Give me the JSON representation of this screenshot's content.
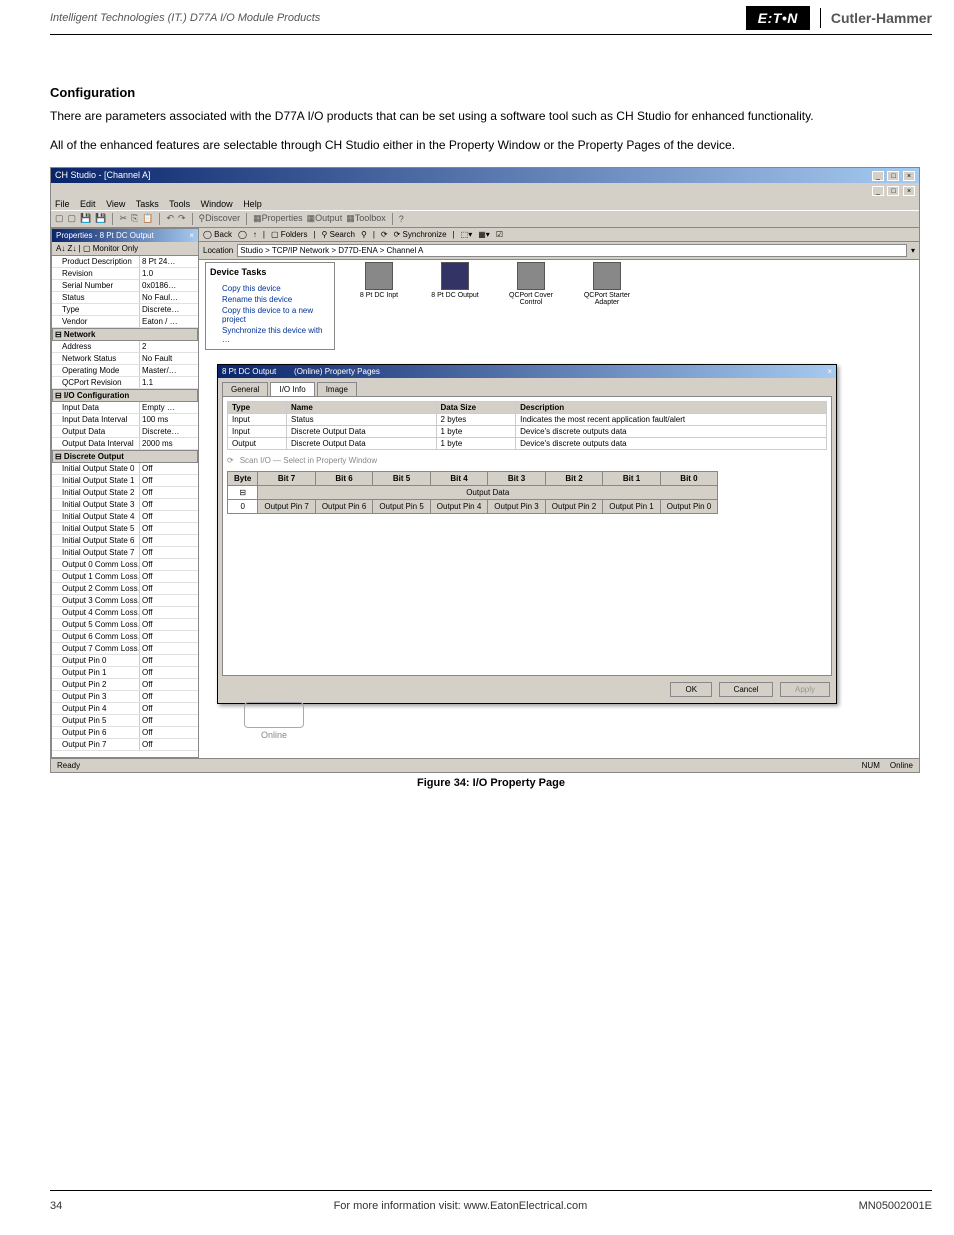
{
  "header": {
    "product_line": "Intelligent Technologies (IT.) D77A I/O Module Products",
    "brand1": "E:T•N",
    "brand2": "Cutler-Hammer"
  },
  "section_title": "Configuration",
  "paragraph1": "There are parameters associated with the D77A I/O products that can be set using a software tool such as CH Studio for enhanced functionality.",
  "paragraph2": "All of the enhanced features are selectable through CH Studio either in the Property Window or the Property Pages of the device.",
  "figure_caption": "Figure 34: I/O Property Page",
  "app": {
    "title": "CH Studio - [Channel A]",
    "menus": [
      "File",
      "Edit",
      "View",
      "Tasks",
      "Tools",
      "Window",
      "Help"
    ],
    "toolbar2": [
      "◯ Back",
      "◯",
      "↑",
      "▢ Folders",
      "⚲ Search",
      "⚲",
      "⟳",
      "⟳ Synchronize",
      "⬚▾",
      "▦▾",
      "☑"
    ],
    "location_label": "Location",
    "location_value": "Studio > TCP/IP Network > D77D-ENA > Channel A",
    "properties": {
      "title": "Properties - 8 Pt DC Output",
      "toolbar": "A↓  Z↓  | ▢ Monitor Only",
      "categories": [
        {
          "name": "",
          "rows": [
            {
              "k": "Product Description",
              "v": "8 Pt 24…"
            },
            {
              "k": "Revision",
              "v": "1.0"
            },
            {
              "k": "Serial Number",
              "v": "0x0186…"
            },
            {
              "k": "Status",
              "v": "No Faul…"
            },
            {
              "k": "Type",
              "v": "Discrete…"
            },
            {
              "k": "Vendor",
              "v": "Eaton / …"
            }
          ]
        },
        {
          "name": "Network",
          "rows": [
            {
              "k": "Address",
              "v": "2"
            },
            {
              "k": "Network Status",
              "v": "No Fault"
            },
            {
              "k": "Operating Mode",
              "v": "Master/…"
            },
            {
              "k": "QCPort Revision",
              "v": "1.1"
            }
          ]
        },
        {
          "name": "I/O Configuration",
          "rows": [
            {
              "k": "Input Data",
              "v": "Empty …"
            },
            {
              "k": "Input Data Interval",
              "v": "100 ms"
            },
            {
              "k": "Output Data",
              "v": "Discrete…"
            },
            {
              "k": "Output Data Interval",
              "v": "2000 ms"
            }
          ]
        },
        {
          "name": "Discrete Output",
          "rows": [
            {
              "k": "Initial Output State 0",
              "v": "Off"
            },
            {
              "k": "Initial Output State 1",
              "v": "Off"
            },
            {
              "k": "Initial Output State 2",
              "v": "Off"
            },
            {
              "k": "Initial Output State 3",
              "v": "Off"
            },
            {
              "k": "Initial Output State 4",
              "v": "Off"
            },
            {
              "k": "Initial Output State 5",
              "v": "Off"
            },
            {
              "k": "Initial Output State 6",
              "v": "Off"
            },
            {
              "k": "Initial Output State 7",
              "v": "Off"
            },
            {
              "k": "Output 0 Comm Loss…",
              "v": "Off"
            },
            {
              "k": "Output 1 Comm Loss…",
              "v": "Off"
            },
            {
              "k": "Output 2 Comm Loss…",
              "v": "Off"
            },
            {
              "k": "Output 3 Comm Loss…",
              "v": "Off"
            },
            {
              "k": "Output 4 Comm Loss…",
              "v": "Off"
            },
            {
              "k": "Output 5 Comm Loss…",
              "v": "Off"
            },
            {
              "k": "Output 6 Comm Loss…",
              "v": "Off"
            },
            {
              "k": "Output 7 Comm Loss…",
              "v": "Off"
            },
            {
              "k": "Output Pin 0",
              "v": "Off"
            },
            {
              "k": "Output Pin 1",
              "v": "Off"
            },
            {
              "k": "Output Pin 2",
              "v": "Off"
            },
            {
              "k": "Output Pin 3",
              "v": "Off"
            },
            {
              "k": "Output Pin 4",
              "v": "Off"
            },
            {
              "k": "Output Pin 5",
              "v": "Off"
            },
            {
              "k": "Output Pin 6",
              "v": "Off"
            },
            {
              "k": "Output Pin 7",
              "v": "Off"
            }
          ]
        }
      ]
    },
    "device_tasks": {
      "title": "Device Tasks",
      "items": [
        "Copy this device",
        "Rename this device",
        "Copy this device to a new project",
        "Synchronize this device with …"
      ]
    },
    "device_icons": [
      {
        "label": "8 Pt DC Inpt"
      },
      {
        "label": "8 Pt DC Output"
      },
      {
        "label": "QCPort Cover Control"
      },
      {
        "label": "QCPort Starter Adapter"
      }
    ],
    "modal": {
      "title_left": "8 Pt DC Output",
      "title_right": "(Online) Property Pages",
      "tabs": [
        "General",
        "I/O Info",
        "Image"
      ],
      "active_tab": 1,
      "io_rows": [
        {
          "type": "Input",
          "name": "Status",
          "size": "2 bytes",
          "desc": "Indicates the most recent application fault/alert"
        },
        {
          "type": "Input",
          "name": "Discrete Output Data",
          "size": "1 byte",
          "desc": "Device's discrete outputs data"
        },
        {
          "type": "Output",
          "name": "Discrete Output Data",
          "size": "1 byte",
          "desc": "Device's discrete outputs data"
        }
      ],
      "scan_text": "Scan I/O — Select in Property Window",
      "bit_header": [
        "Byte",
        "Bit 7",
        "Bit 6",
        "Bit 5",
        "Bit 4",
        "Bit 3",
        "Bit 2",
        "Bit 1",
        "Bit 0"
      ],
      "bit_group": "Output Data",
      "bit_row0": "0",
      "bit_cells": [
        "Output Pin 7",
        "Output Pin 6",
        "Output Pin 5",
        "Output Pin 4",
        "Output Pin 3",
        "Output Pin 2",
        "Output Pin 1",
        "Output Pin 0"
      ],
      "buttons": {
        "ok": "OK",
        "cancel": "Cancel",
        "apply": "Apply"
      }
    },
    "online_label": "Online",
    "status": {
      "left": "Ready",
      "right": [
        "NUM",
        "Online"
      ]
    }
  },
  "footer": {
    "page": "34",
    "center": "For more information visit: www.EatonElectrical.com",
    "right": "MN05002001E"
  }
}
